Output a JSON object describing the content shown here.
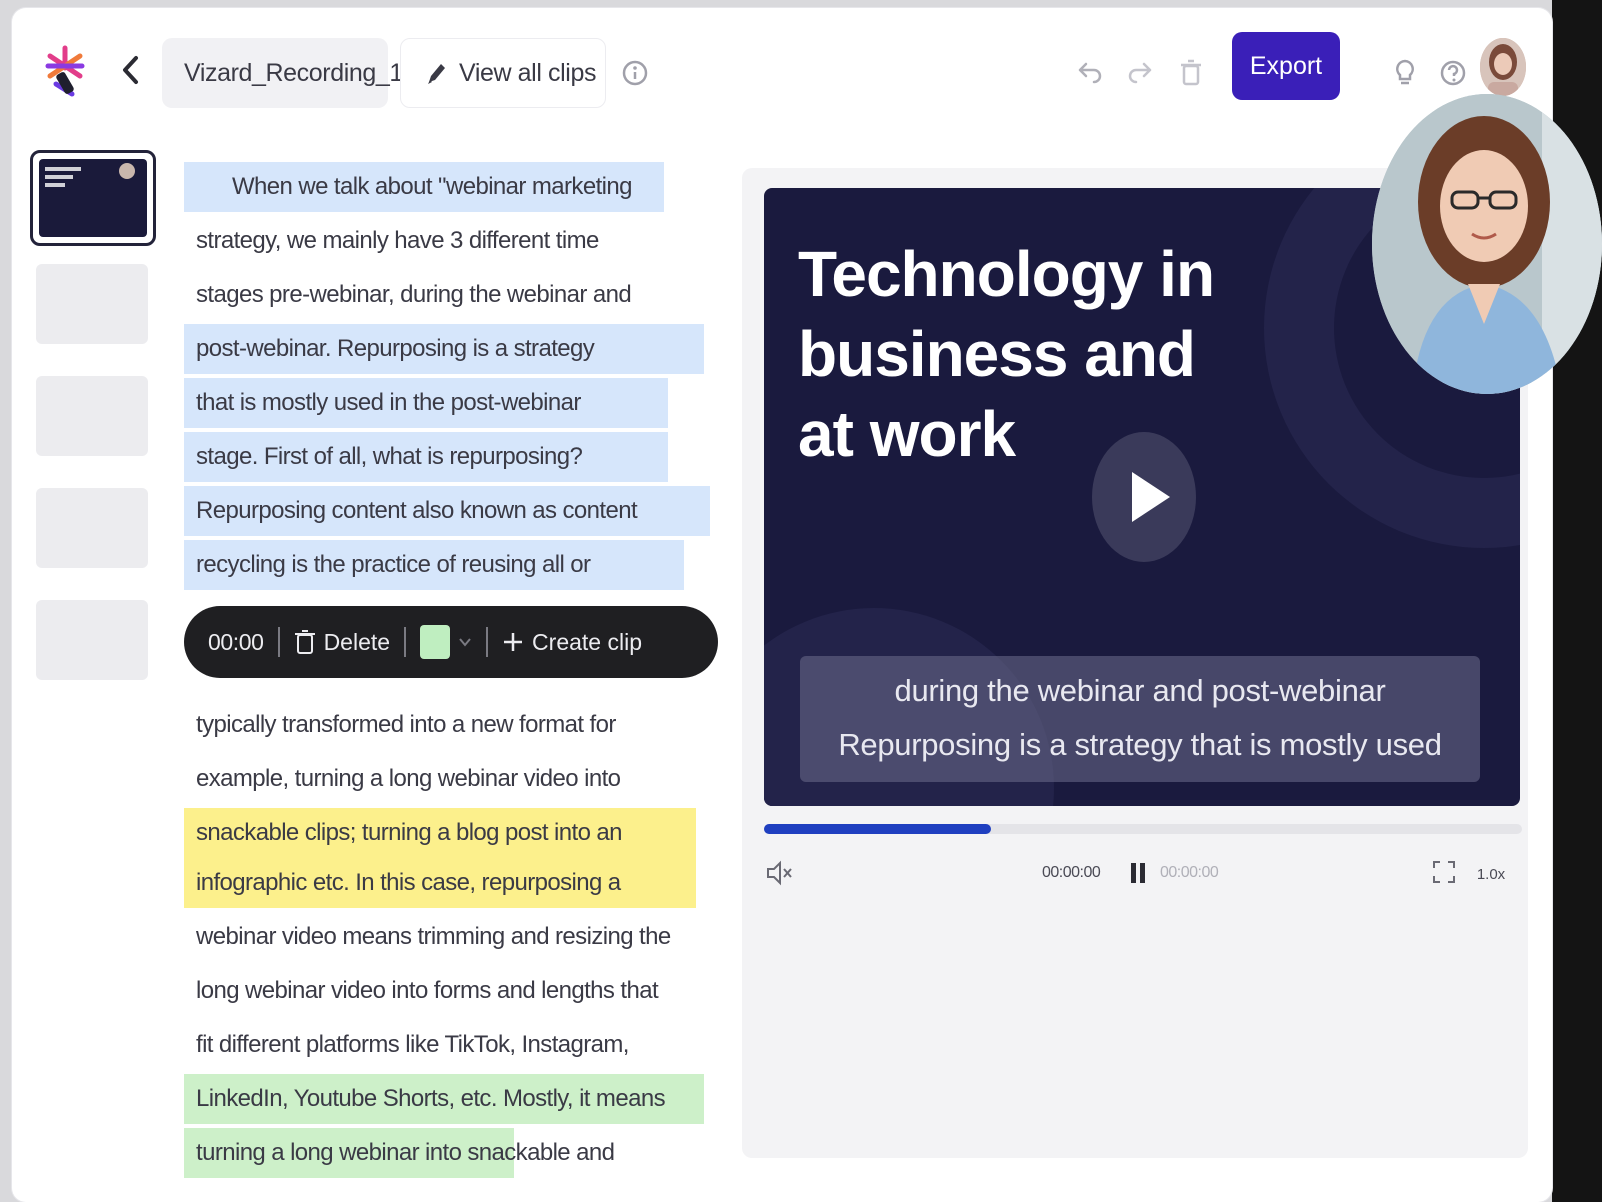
{
  "header": {
    "file_name": "Vizard_Recording_1",
    "view_clips_label": "View all clips",
    "export_label": "Export"
  },
  "transcript": {
    "lines": [
      "When we talk about \"webinar      marketing",
      "strategy, we mainly have 3      different time",
      "stages pre-webinar, during the webinar and",
      "post-webinar.       Repurposing is a strategy",
      "that is mostly used in the post-webinar",
      "stage.       First of all, what is repurposing?",
      "Repurposing content also known as content",
      "recycling is the practice of reusing all or",
      "",
      "typically transformed into a new format for",
      "example, turning a long webinar video into",
      "snackable clips; turning a blog post into an",
      "infographic etc. In this case, repurposing a",
      "webinar video means trimming and resizing the",
      "long webinar video into forms and lengths that",
      "fit different platforms like TikTok, Instagram,",
      "LinkedIn, Youtube Shorts, etc. Mostly, it means",
      "turning a long webinar into snackable and"
    ]
  },
  "clip_toolbar": {
    "time": "00:00",
    "delete_label": "Delete",
    "create_clip_label": "Create clip",
    "swatch_color": "#bfeec0"
  },
  "video": {
    "title": "Technology in business and at work",
    "caption_line1": "during the webinar and post-webinar",
    "caption_line2": "Repurposing is a strategy that is mostly used",
    "progress_percent": 30,
    "speed": "1.0x"
  },
  "colors": {
    "accent": "#3a1fb8",
    "progress": "#1f3fc0",
    "highlight_blue": "#d6e6fb",
    "highlight_yellow": "#fcf08c",
    "highlight_green": "#cdf0c9",
    "video_bg": "#1a1a3e"
  }
}
